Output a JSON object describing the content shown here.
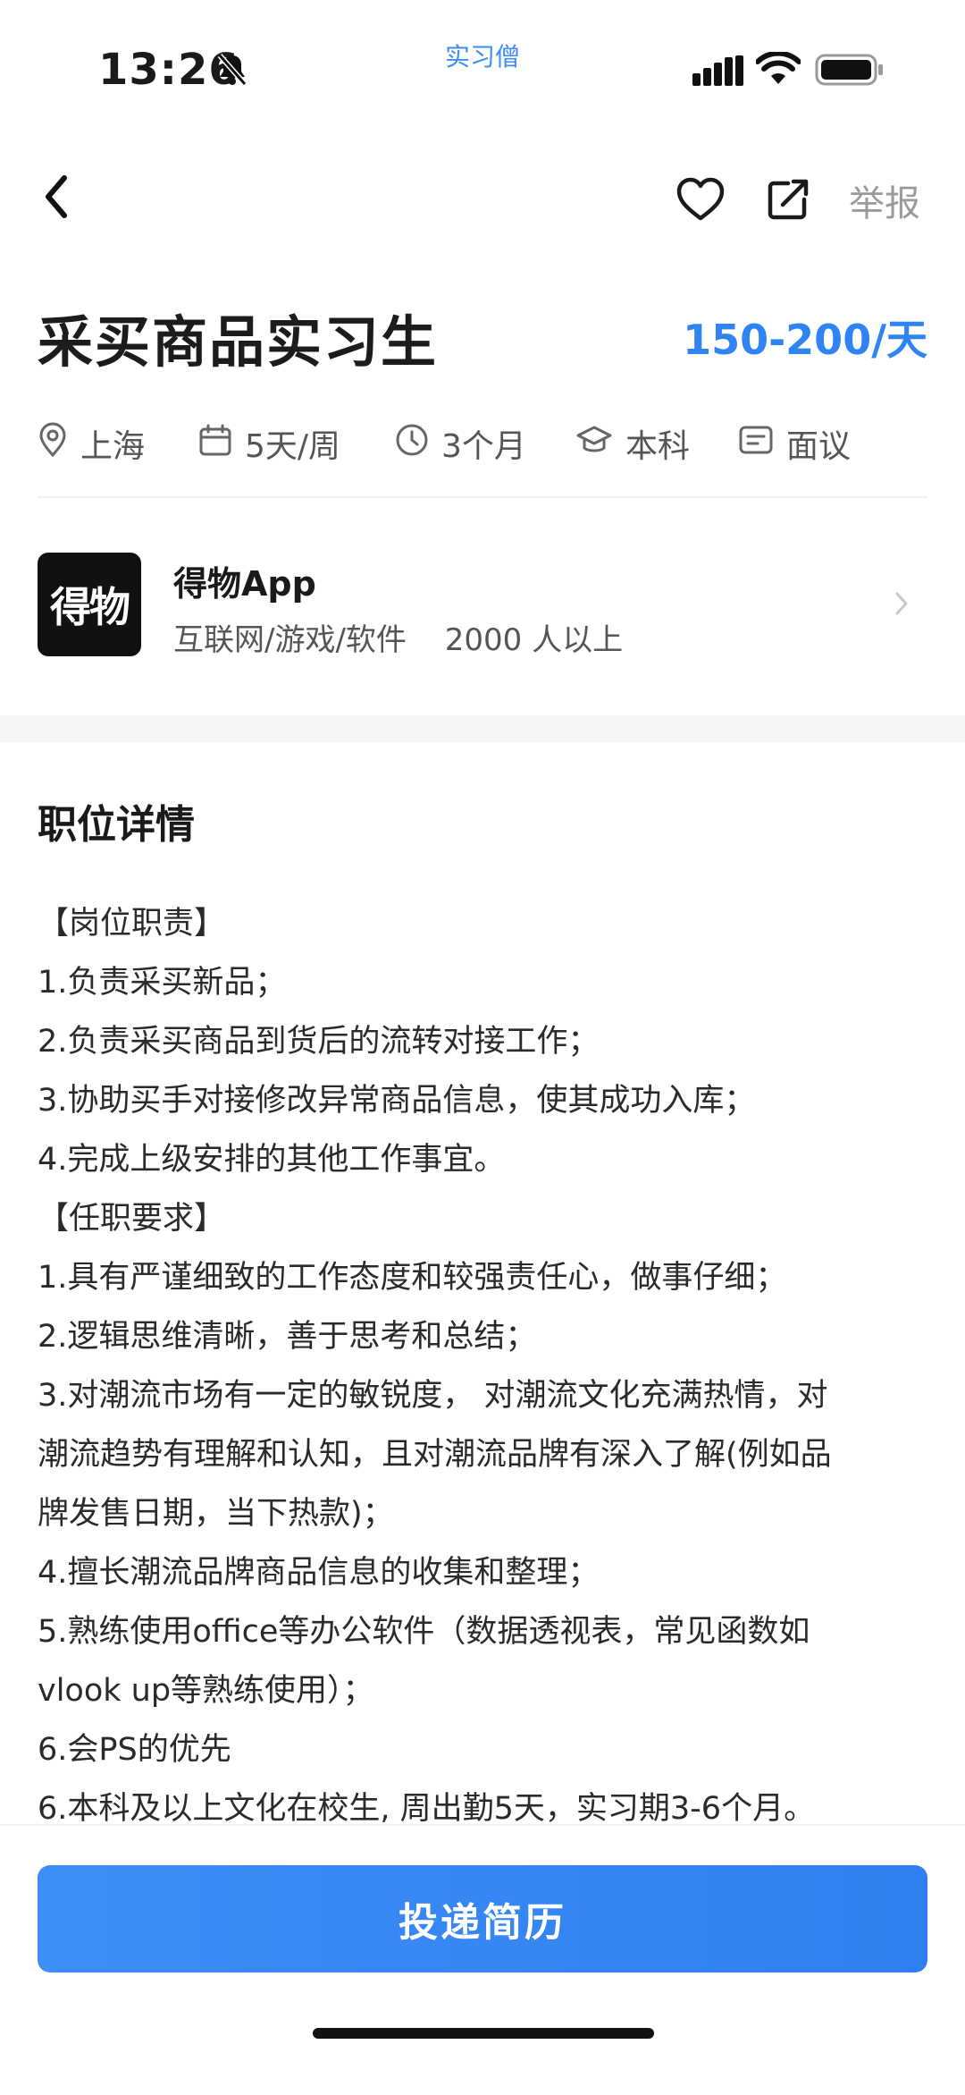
{
  "status": {
    "time": "13:26",
    "app_tag": "实习僧"
  },
  "nav": {
    "report_label": "举报"
  },
  "job": {
    "title": "采买商品实习生",
    "salary": "150-200/天",
    "tags": [
      {
        "icon": "location-icon",
        "text": "上海"
      },
      {
        "icon": "calendar-icon",
        "text": "5天/周"
      },
      {
        "icon": "clock-icon",
        "text": "3个月"
      },
      {
        "icon": "education-icon",
        "text": "本科"
      },
      {
        "icon": "interview-icon",
        "text": "面议"
      }
    ]
  },
  "company": {
    "logo_text": "得物",
    "name": "得物App",
    "industry": "互联网/游戏/软件",
    "size": "2000 人以上"
  },
  "details": {
    "title": "职位详情",
    "lines": [
      "【岗位职责】",
      "1.负责采买新品；",
      "2.负责采买商品到货后的流转对接工作；",
      "3.协助买手对接修改异常商品信息，使其成功入库；",
      "4.完成上级安排的其他工作事宜。",
      "【任职要求】",
      "1.具有严谨细致的工作态度和较强责任心，做事仔细；",
      "2.逻辑思维清晰，善于思考和总结；",
      "3.对潮流市场有一定的敏锐度， 对潮流文化充满热情，对",
      "潮流趋势有理解和认知，且对潮流品牌有深入了解(例如品",
      "牌发售日期，当下热款)；",
      "4.擅长潮流品牌商品信息的收集和整理；",
      "5.熟练使用office等办公软件（数据透视表，常见函数如",
      "vlook up等熟练使用）；",
      "6.会PS的优先",
      "6.本科及以上文化在校生, 周出勤5天，实习期3-6个月。"
    ]
  },
  "apply_label": "投递简历",
  "colors": {
    "accent": "#2f84f4",
    "button": "#3388f5"
  }
}
